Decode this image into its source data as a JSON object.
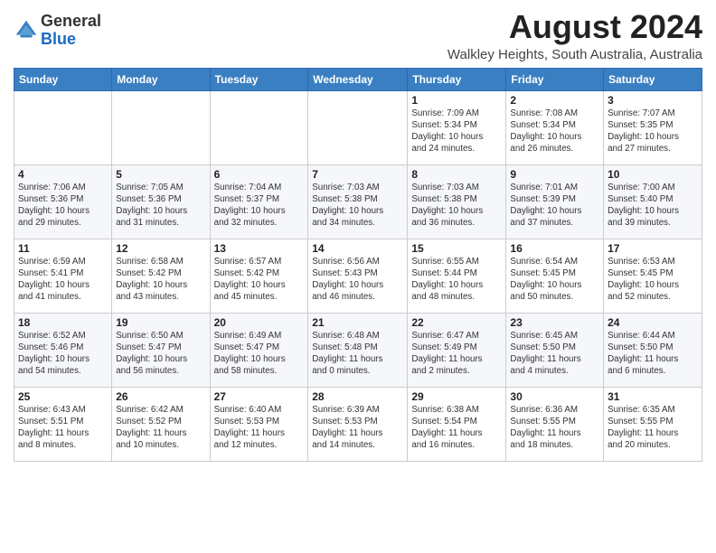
{
  "header": {
    "logo_line1": "General",
    "logo_line2": "Blue",
    "title": "August 2024",
    "subtitle": "Walkley Heights, South Australia, Australia"
  },
  "days_of_week": [
    "Sunday",
    "Monday",
    "Tuesday",
    "Wednesday",
    "Thursday",
    "Friday",
    "Saturday"
  ],
  "weeks": [
    [
      {
        "day": "",
        "info": ""
      },
      {
        "day": "",
        "info": ""
      },
      {
        "day": "",
        "info": ""
      },
      {
        "day": "",
        "info": ""
      },
      {
        "day": "1",
        "info": "Sunrise: 7:09 AM\nSunset: 5:34 PM\nDaylight: 10 hours\nand 24 minutes."
      },
      {
        "day": "2",
        "info": "Sunrise: 7:08 AM\nSunset: 5:34 PM\nDaylight: 10 hours\nand 26 minutes."
      },
      {
        "day": "3",
        "info": "Sunrise: 7:07 AM\nSunset: 5:35 PM\nDaylight: 10 hours\nand 27 minutes."
      }
    ],
    [
      {
        "day": "4",
        "info": "Sunrise: 7:06 AM\nSunset: 5:36 PM\nDaylight: 10 hours\nand 29 minutes."
      },
      {
        "day": "5",
        "info": "Sunrise: 7:05 AM\nSunset: 5:36 PM\nDaylight: 10 hours\nand 31 minutes."
      },
      {
        "day": "6",
        "info": "Sunrise: 7:04 AM\nSunset: 5:37 PM\nDaylight: 10 hours\nand 32 minutes."
      },
      {
        "day": "7",
        "info": "Sunrise: 7:03 AM\nSunset: 5:38 PM\nDaylight: 10 hours\nand 34 minutes."
      },
      {
        "day": "8",
        "info": "Sunrise: 7:03 AM\nSunset: 5:38 PM\nDaylight: 10 hours\nand 36 minutes."
      },
      {
        "day": "9",
        "info": "Sunrise: 7:01 AM\nSunset: 5:39 PM\nDaylight: 10 hours\nand 37 minutes."
      },
      {
        "day": "10",
        "info": "Sunrise: 7:00 AM\nSunset: 5:40 PM\nDaylight: 10 hours\nand 39 minutes."
      }
    ],
    [
      {
        "day": "11",
        "info": "Sunrise: 6:59 AM\nSunset: 5:41 PM\nDaylight: 10 hours\nand 41 minutes."
      },
      {
        "day": "12",
        "info": "Sunrise: 6:58 AM\nSunset: 5:42 PM\nDaylight: 10 hours\nand 43 minutes."
      },
      {
        "day": "13",
        "info": "Sunrise: 6:57 AM\nSunset: 5:42 PM\nDaylight: 10 hours\nand 45 minutes."
      },
      {
        "day": "14",
        "info": "Sunrise: 6:56 AM\nSunset: 5:43 PM\nDaylight: 10 hours\nand 46 minutes."
      },
      {
        "day": "15",
        "info": "Sunrise: 6:55 AM\nSunset: 5:44 PM\nDaylight: 10 hours\nand 48 minutes."
      },
      {
        "day": "16",
        "info": "Sunrise: 6:54 AM\nSunset: 5:45 PM\nDaylight: 10 hours\nand 50 minutes."
      },
      {
        "day": "17",
        "info": "Sunrise: 6:53 AM\nSunset: 5:45 PM\nDaylight: 10 hours\nand 52 minutes."
      }
    ],
    [
      {
        "day": "18",
        "info": "Sunrise: 6:52 AM\nSunset: 5:46 PM\nDaylight: 10 hours\nand 54 minutes."
      },
      {
        "day": "19",
        "info": "Sunrise: 6:50 AM\nSunset: 5:47 PM\nDaylight: 10 hours\nand 56 minutes."
      },
      {
        "day": "20",
        "info": "Sunrise: 6:49 AM\nSunset: 5:47 PM\nDaylight: 10 hours\nand 58 minutes."
      },
      {
        "day": "21",
        "info": "Sunrise: 6:48 AM\nSunset: 5:48 PM\nDaylight: 11 hours\nand 0 minutes."
      },
      {
        "day": "22",
        "info": "Sunrise: 6:47 AM\nSunset: 5:49 PM\nDaylight: 11 hours\nand 2 minutes."
      },
      {
        "day": "23",
        "info": "Sunrise: 6:45 AM\nSunset: 5:50 PM\nDaylight: 11 hours\nand 4 minutes."
      },
      {
        "day": "24",
        "info": "Sunrise: 6:44 AM\nSunset: 5:50 PM\nDaylight: 11 hours\nand 6 minutes."
      }
    ],
    [
      {
        "day": "25",
        "info": "Sunrise: 6:43 AM\nSunset: 5:51 PM\nDaylight: 11 hours\nand 8 minutes."
      },
      {
        "day": "26",
        "info": "Sunrise: 6:42 AM\nSunset: 5:52 PM\nDaylight: 11 hours\nand 10 minutes."
      },
      {
        "day": "27",
        "info": "Sunrise: 6:40 AM\nSunset: 5:53 PM\nDaylight: 11 hours\nand 12 minutes."
      },
      {
        "day": "28",
        "info": "Sunrise: 6:39 AM\nSunset: 5:53 PM\nDaylight: 11 hours\nand 14 minutes."
      },
      {
        "day": "29",
        "info": "Sunrise: 6:38 AM\nSunset: 5:54 PM\nDaylight: 11 hours\nand 16 minutes."
      },
      {
        "day": "30",
        "info": "Sunrise: 6:36 AM\nSunset: 5:55 PM\nDaylight: 11 hours\nand 18 minutes."
      },
      {
        "day": "31",
        "info": "Sunrise: 6:35 AM\nSunset: 5:55 PM\nDaylight: 11 hours\nand 20 minutes."
      }
    ]
  ]
}
